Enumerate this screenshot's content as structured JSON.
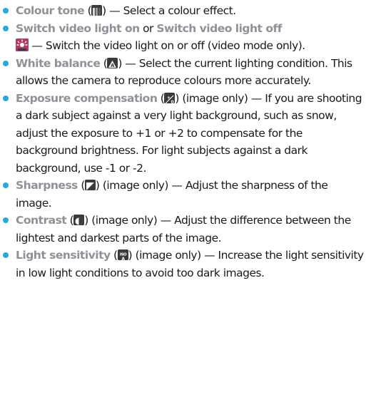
{
  "colors": {
    "bullet": "#25a9e0",
    "term": "#8e9197",
    "text": "#1a1a1a"
  },
  "items": [
    {
      "term": "Colour tone",
      "open": " (",
      "icon": "colour-tone-icon",
      "close": ")",
      "text": " — Select a colour effect."
    },
    {
      "term": "Switch video light on",
      "connector": " or ",
      "term2": "Switch video light off",
      "icon": "video-light-icon",
      "text": " — Switch the video light on or off (video mode only)."
    },
    {
      "term": "White balance",
      "open": " (",
      "icon": "white-balance-icon",
      "close": ")",
      "text": "  — Select the current lighting condition. This allows the camera to reproduce colours more accurately."
    },
    {
      "term": "Exposure compensation",
      "open": " (",
      "icon": "exposure-compensation-icon",
      "close": ")",
      "text": " (image only) — If you are shooting a dark subject against a very light background, such as snow, adjust the exposure to +1 or +2 to compensate for the background brightness. For light subjects against a dark background, use -1 or -2."
    },
    {
      "term": "Sharpness",
      "open": " (",
      "icon": "sharpness-icon",
      "close": ")",
      "text": " (image only)  — Adjust the sharpness of the image."
    },
    {
      "term": "Contrast",
      "open": " (",
      "icon": "contrast-icon",
      "close": ")",
      "text": " (image only)  — Adjust the difference between the lightest and darkest parts of the image."
    },
    {
      "term": "Light sensitivity",
      "open": " (",
      "icon": "light-sensitivity-icon",
      "close": ")",
      "text": " (image only)  — Increase the light sensitivity in low light conditions to avoid too dark images."
    }
  ]
}
